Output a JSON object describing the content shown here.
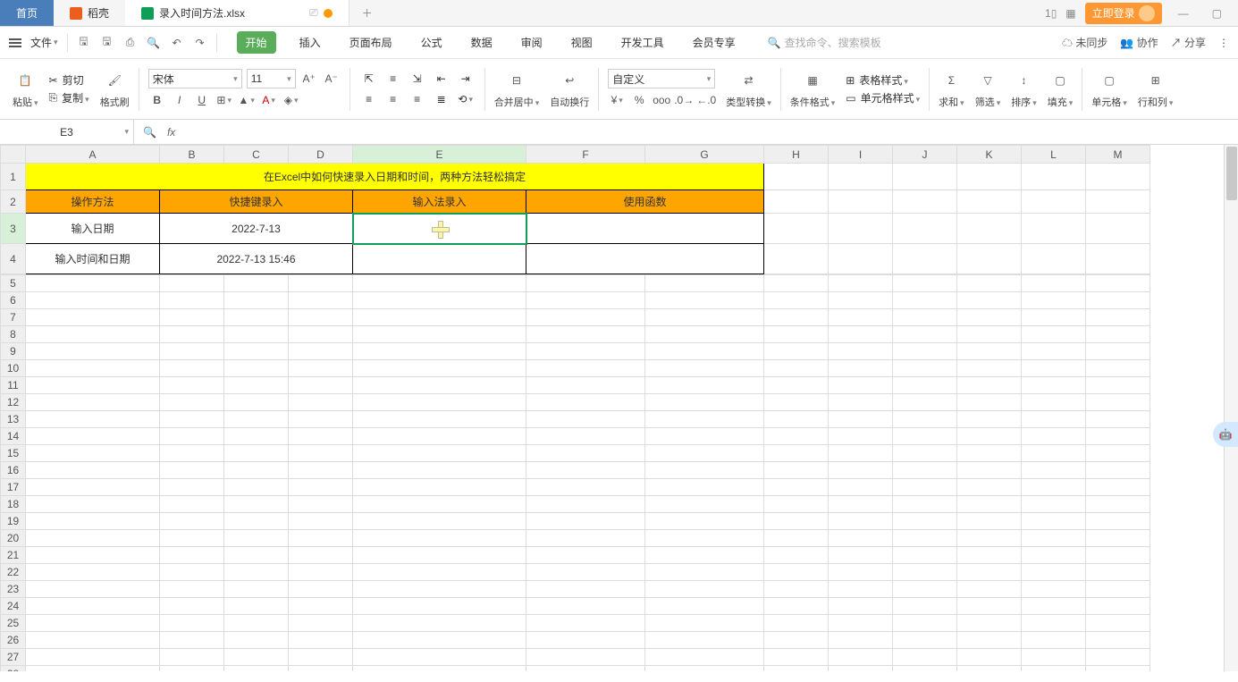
{
  "titlebar": {
    "home_tab": "首页",
    "docker_tab": "稻壳",
    "file_tab": "录入时间方法.xlsx",
    "login_label": "立即登录"
  },
  "menubar": {
    "file_label": "文件",
    "tabs": {
      "start": "开始",
      "insert": "插入",
      "layout": "页面布局",
      "formula": "公式",
      "data": "数据",
      "review": "审阅",
      "view": "视图",
      "dev": "开发工具",
      "member": "会员专享"
    },
    "search_placeholder": "查找命令、搜索模板",
    "unsync": "未同步",
    "collab": "协作",
    "share": "分享"
  },
  "ribbon": {
    "paste": "粘贴",
    "cut": "剪切",
    "copy": "复制",
    "format_brush": "格式刷",
    "font": "宋体",
    "font_size": "11",
    "merge": "合并居中",
    "wrap": "自动换行",
    "num_format": "自定义",
    "type_convert": "类型转换",
    "cond_format": "条件格式",
    "table_style": "表格样式",
    "cell_style": "单元格样式",
    "sum": "求和",
    "filter": "筛选",
    "sort": "排序",
    "fill": "填充",
    "cell": "单元格",
    "rowcol": "行和列"
  },
  "formula_bar": {
    "name_box": "E3",
    "fx": "fx"
  },
  "columns": [
    "A",
    "B",
    "C",
    "D",
    "E",
    "F",
    "G",
    "H",
    "I",
    "J",
    "K",
    "L",
    "M"
  ],
  "sheet": {
    "title": "在Excel中如何快速录入日期和时间，两种方法轻松搞定",
    "headers": {
      "method": "操作方法",
      "shortcut": "快捷键录入",
      "ime": "输入法录入",
      "func": "使用函数"
    },
    "rows": {
      "r3_label": "输入日期",
      "r3_shortcut": "2022-7-13",
      "r4_label": "输入时间和日期",
      "r4_shortcut": "2022-7-13 15:46"
    }
  }
}
